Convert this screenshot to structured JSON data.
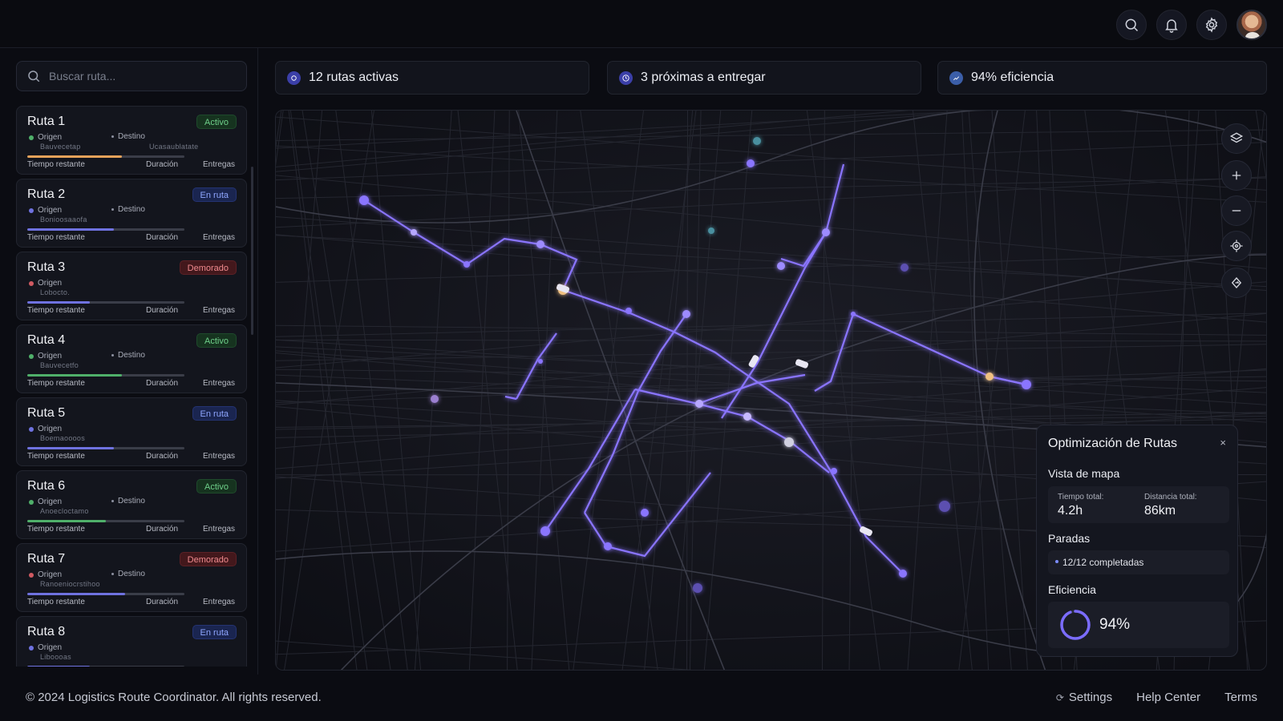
{
  "header": {
    "icons": [
      "search-icon",
      "bell-icon",
      "gear-icon",
      "user-avatar"
    ]
  },
  "sidebar": {
    "search_placeholder": "Buscar ruta...",
    "labels": {
      "origin": "Origen",
      "destination": "Destino",
      "time_remaining": "Tiempo restante",
      "duration": "Duración",
      "deliveries": "Entregas"
    },
    "routes": [
      {
        "name": "Ruta 1",
        "status": "Activo",
        "origin_value": "Bauvecetap",
        "destination_value": "Ucasaublatate",
        "progress": 0.6,
        "color": "#e6a25a",
        "has_destination": true
      },
      {
        "name": "Ruta 2",
        "status": "En ruta",
        "origin_value": "Bonioosaaofa",
        "destination_value": "",
        "progress": 0.55,
        "color": "#6f72e0",
        "has_destination": true
      },
      {
        "name": "Ruta 3",
        "status": "Demorado",
        "origin_value": "Lobocto.",
        "destination_value": "",
        "progress": 0.4,
        "color": "#6f72e0",
        "has_destination": false
      },
      {
        "name": "Ruta 4",
        "status": "Activo",
        "origin_value": "Bauvecetfo",
        "destination_value": "",
        "progress": 0.6,
        "color": "#4fb06a",
        "has_destination": true
      },
      {
        "name": "Ruta 5",
        "status": "En ruta",
        "origin_value": "Boemaoooos",
        "destination_value": "",
        "progress": 0.55,
        "color": "#6f72e0",
        "has_destination": false
      },
      {
        "name": "Ruta 6",
        "status": "Activo",
        "origin_value": "Anoecloctamo",
        "destination_value": "",
        "progress": 0.5,
        "color": "#4fb06a",
        "has_destination": true
      },
      {
        "name": "Ruta 7",
        "status": "Demorado",
        "origin_value": "Ranoeniocrstihoo",
        "destination_value": "",
        "progress": 0.62,
        "color": "#6f72e0",
        "has_destination": true
      },
      {
        "name": "Ruta 8",
        "status": "En ruta",
        "origin_value": "Liboooas",
        "destination_value": "",
        "progress": 0.4,
        "color": "#6f72e0",
        "has_destination": false
      }
    ]
  },
  "stats": [
    {
      "label": "12 rutas activas",
      "icon": "route-icon"
    },
    {
      "label": "3 próximas a entregar",
      "icon": "clock-icon"
    },
    {
      "label": "94% eficiencia",
      "icon": "efficiency-icon"
    }
  ],
  "map": {
    "controls": [
      "layers-icon",
      "zoom-in-icon",
      "zoom-out-icon",
      "locate-icon",
      "navigate-icon"
    ]
  },
  "optimization": {
    "title": "Optimización de Rutas",
    "close": "×",
    "map_view_heading": "Vista de mapa",
    "total_time_label": "Tiempo total:",
    "total_time_value": "4.2h",
    "total_distance_label": "Distancia total:",
    "total_distance_value": "86km",
    "stops_heading": "Paradas",
    "stops_value": "12/12 completadas",
    "efficiency_heading": "Eficiencia",
    "efficiency_value": "94%",
    "efficiency_fraction": 0.94
  },
  "footer": {
    "copyright": "© 2024 Logistics Route Coordinator. All rights reserved.",
    "links": [
      "Settings",
      "Help Center",
      "Terms"
    ]
  },
  "colors": {
    "accent": "#7b6cff",
    "route_glow": "#8a74ff",
    "activo": "#6fd08a",
    "en_ruta": "#8fa6ff",
    "demorado": "#f08a8e"
  }
}
